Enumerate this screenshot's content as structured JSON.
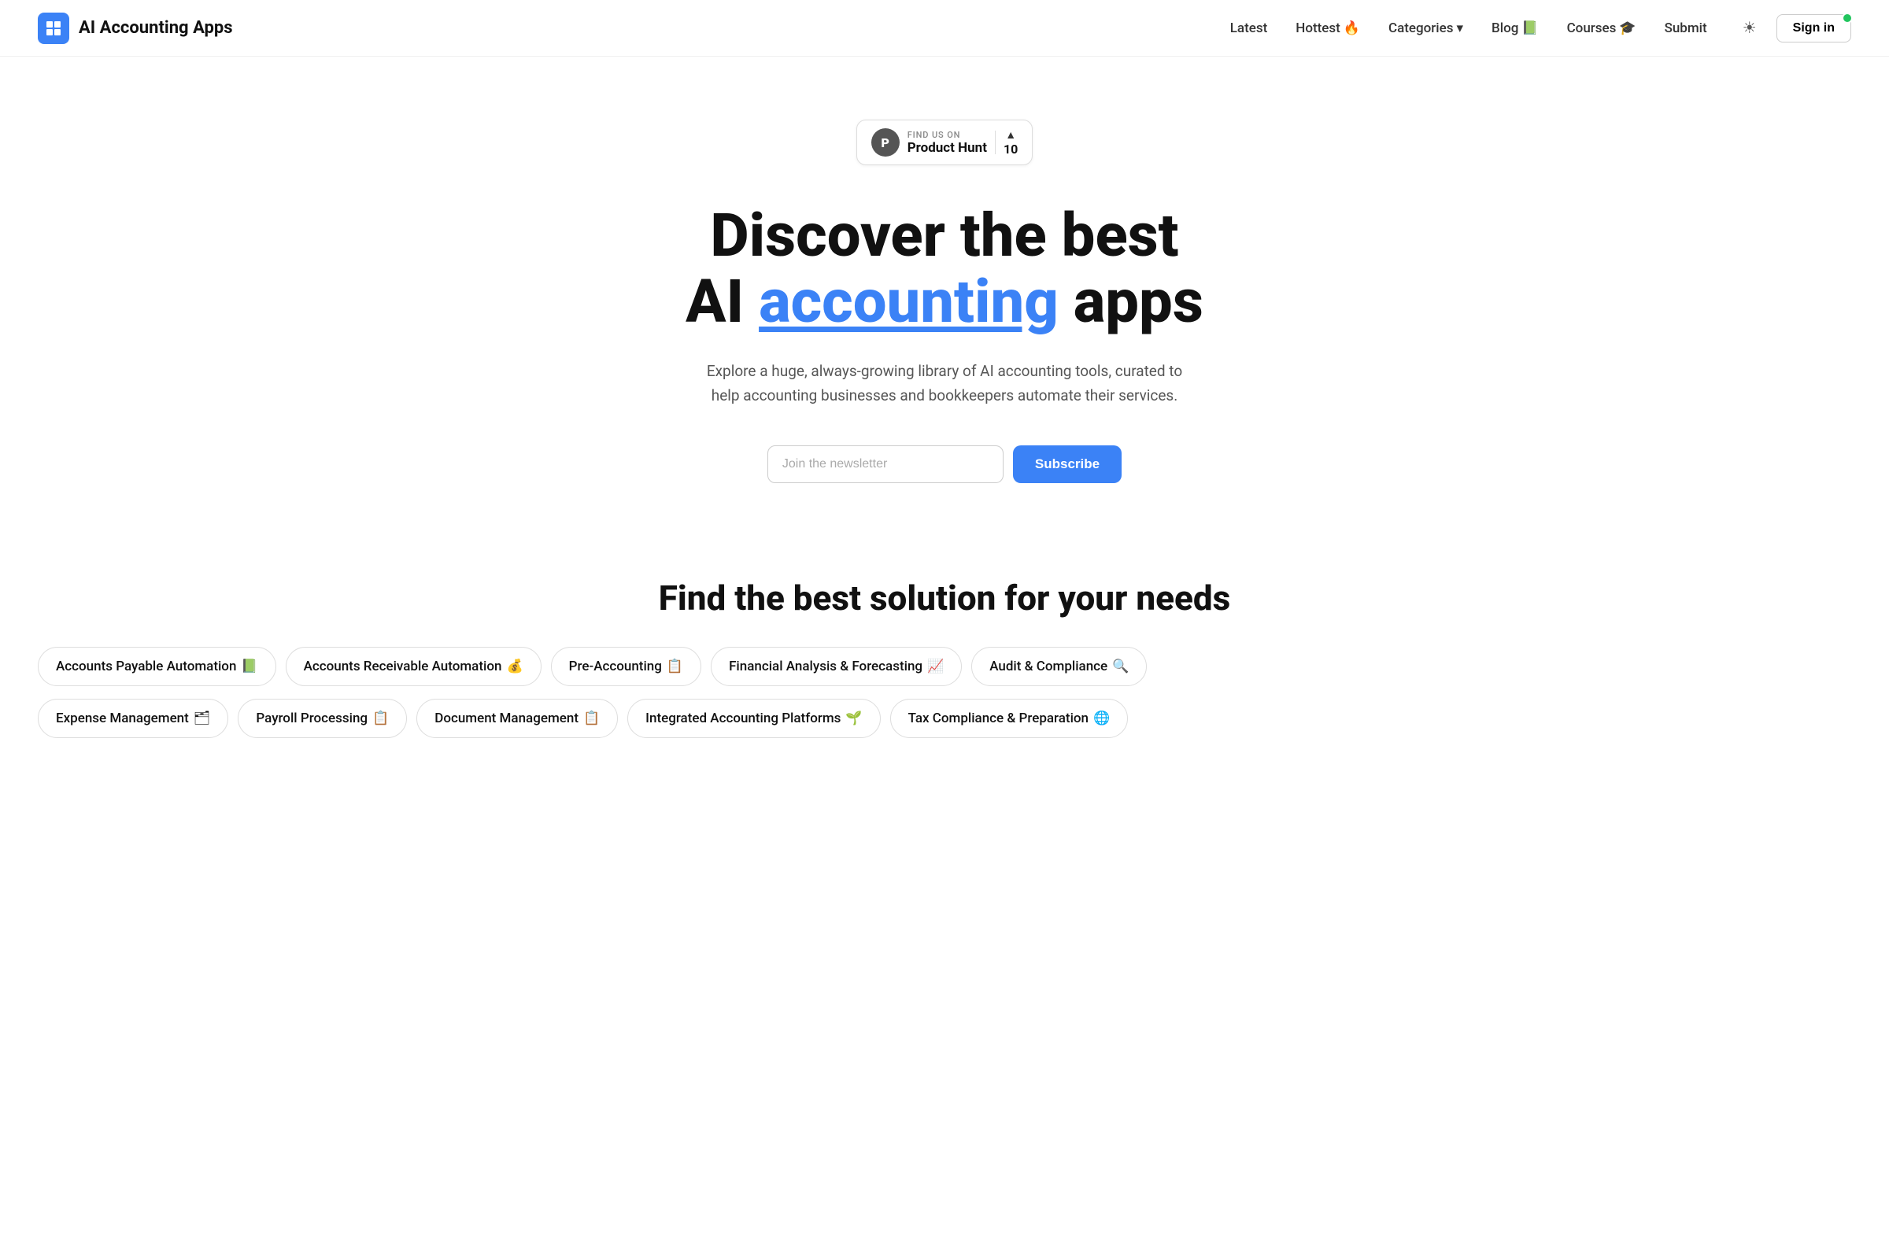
{
  "header": {
    "logo_text": "AI Accounting Apps",
    "logo_icon": "⚙",
    "nav": [
      {
        "label": "Latest",
        "emoji": ""
      },
      {
        "label": "Hottest",
        "emoji": "🔥"
      },
      {
        "label": "Categories",
        "emoji": "",
        "has_dropdown": true
      },
      {
        "label": "Blog",
        "emoji": "📗"
      },
      {
        "label": "Courses",
        "emoji": "🎓"
      },
      {
        "label": "Submit",
        "emoji": ""
      }
    ],
    "theme_icon": "☀",
    "sign_in": "Sign in"
  },
  "product_hunt": {
    "find_us_label": "FIND US ON",
    "name": "Product Hunt",
    "votes": "10"
  },
  "hero": {
    "title_line1": "Discover the best",
    "title_line2_pre": "AI ",
    "title_accent": "accounting",
    "title_line2_post": " apps",
    "subtitle": "Explore a huge, always-growing library of AI accounting tools, curated to help accounting businesses and bookkeepers automate their services.",
    "newsletter_placeholder": "Join the newsletter",
    "subscribe_label": "Subscribe"
  },
  "solutions": {
    "section_title": "Find the best solution for your needs",
    "categories_row1": [
      {
        "label": "Accounts Payable Automation",
        "emoji": "📗"
      },
      {
        "label": "Accounts Receivable Automation",
        "emoji": "💰"
      },
      {
        "label": "Pre-Accounting",
        "emoji": "📋"
      },
      {
        "label": "Financial Analysis & Forecasting",
        "emoji": "📈"
      },
      {
        "label": "Audit & Compliance",
        "emoji": "🔍"
      }
    ],
    "categories_row2": [
      {
        "label": "Expense Management",
        "emoji": "🗂"
      },
      {
        "label": "Payroll Processing",
        "emoji": "📋"
      },
      {
        "label": "Document Management",
        "emoji": "📋"
      },
      {
        "label": "Integrated Accounting Platforms",
        "emoji": "🌱"
      },
      {
        "label": "Tax Compliance & Preparation",
        "emoji": "🌐"
      }
    ]
  }
}
